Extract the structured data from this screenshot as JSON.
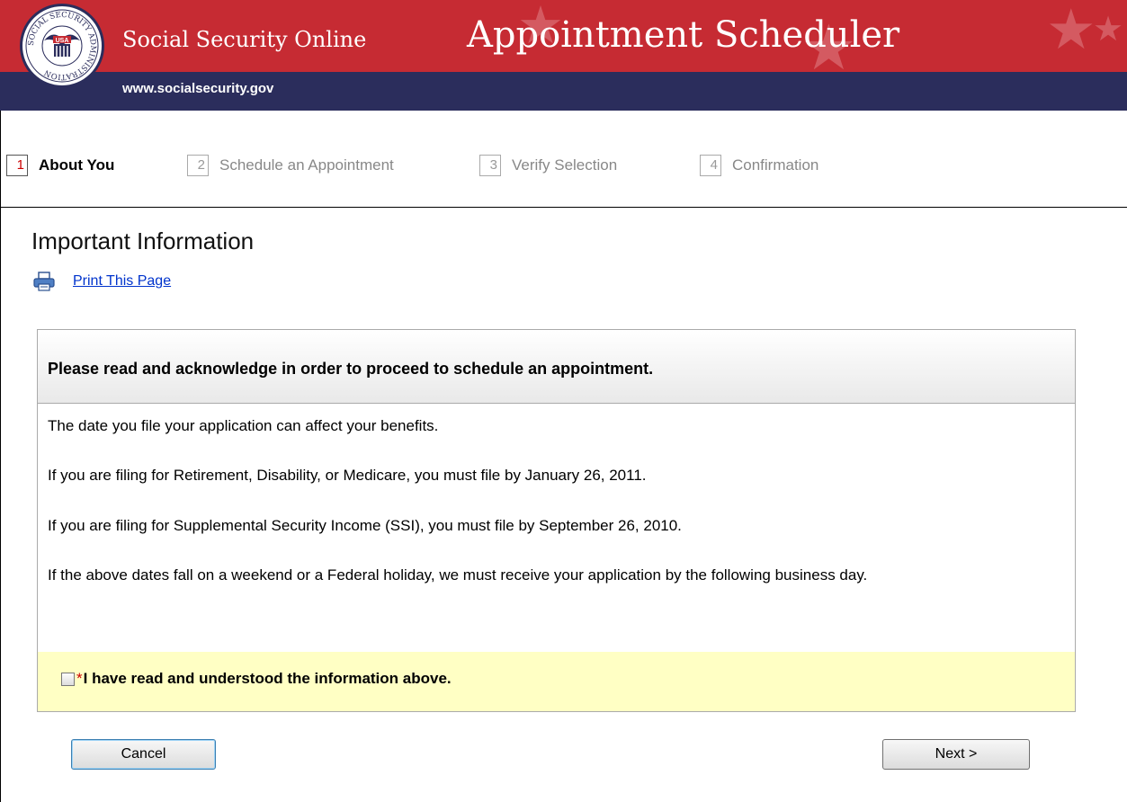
{
  "header": {
    "site_name": "Social Security Online",
    "app_title": "Appointment Scheduler",
    "url": "www.socialsecurity.gov",
    "seal_text": "SOCIAL SECURITY ADMINISTRATION",
    "seal_center": "USA"
  },
  "steps": [
    {
      "number": "1",
      "label": "About You",
      "active": true
    },
    {
      "number": "2",
      "label": "Schedule an Appointment",
      "active": false
    },
    {
      "number": "3",
      "label": "Verify Selection",
      "active": false
    },
    {
      "number": "4",
      "label": "Confirmation",
      "active": false
    }
  ],
  "main": {
    "title": "Important Information",
    "print_link": "Print This Page",
    "info_heading": "Please read and acknowledge in order to proceed to schedule an appointment.",
    "paragraphs": [
      "The date you file your application can affect your benefits.",
      "If you are filing for Retirement, Disability, or Medicare, you must file by January 26, 2011.",
      "If you are filing for Supplemental Security Income (SSI), you must file by September 26, 2010.",
      "If the above dates fall on a weekend or a Federal holiday, we must receive your application by the following business day."
    ],
    "acknowledge": {
      "required_marker": "*",
      "label": "I have read and understood the information above.",
      "checked": false
    }
  },
  "buttons": {
    "cancel": "Cancel",
    "next": "Next >"
  },
  "colors": {
    "banner_red": "#c62b33",
    "banner_navy": "#2b2d5c",
    "link_blue": "#0033cc",
    "ack_yellow": "#ffffc4"
  },
  "icons": [
    "seal-logo",
    "star-icon",
    "printer-icon",
    "checkbox"
  ]
}
